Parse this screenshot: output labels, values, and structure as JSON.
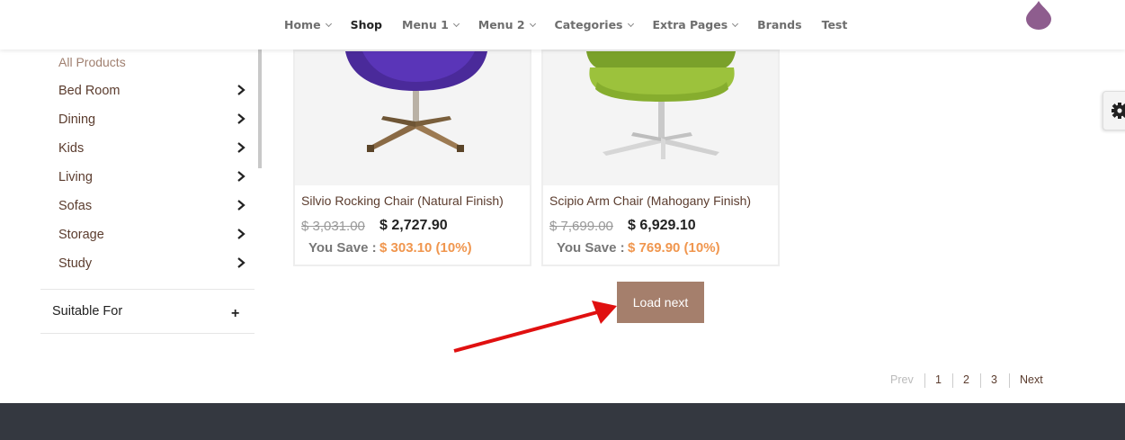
{
  "nav": {
    "items": [
      {
        "label": "Home",
        "dropdown": true,
        "active": false
      },
      {
        "label": "Shop",
        "dropdown": false,
        "active": true
      },
      {
        "label": "Menu 1",
        "dropdown": true,
        "active": false
      },
      {
        "label": "Menu 2",
        "dropdown": true,
        "active": false
      },
      {
        "label": "Categories",
        "dropdown": true,
        "active": false
      },
      {
        "label": "Extra Pages",
        "dropdown": true,
        "active": false
      },
      {
        "label": "Brands",
        "dropdown": false,
        "active": false
      },
      {
        "label": "Test",
        "dropdown": false,
        "active": false
      }
    ],
    "logo_icon": "drop-logo-icon",
    "logo_color": "#8e5d8e"
  },
  "sidebar": {
    "all_products": "All Products",
    "categories": [
      "Bed Room",
      "Dining",
      "Kids",
      "Living",
      "Sofas",
      "Storage",
      "Study"
    ],
    "filter_title": "Suitable For",
    "filter_icon": "plus-icon"
  },
  "products": [
    {
      "name": "Silvio Rocking Chair (Natural Finish)",
      "old_price": "$ 3,031.00",
      "price": "$ 2,727.90",
      "save_label": "You Save :",
      "save_value": "$ 303.10 (10%)"
    },
    {
      "name": "Scipio Arm Chair (Mahogany Finish)",
      "old_price": "$ 7,699.00",
      "price": "$ 6,929.10",
      "save_label": "You Save :",
      "save_value": "$ 769.90 (10%)"
    }
  ],
  "load_next": "Load next",
  "pagination": {
    "prev": "Prev",
    "pages": [
      "1",
      "2",
      "3"
    ],
    "next": "Next"
  },
  "colors": {
    "brand": "#a57f6c",
    "accent": "#f0964e",
    "footer": "#343840",
    "annotation": "#e01010"
  }
}
